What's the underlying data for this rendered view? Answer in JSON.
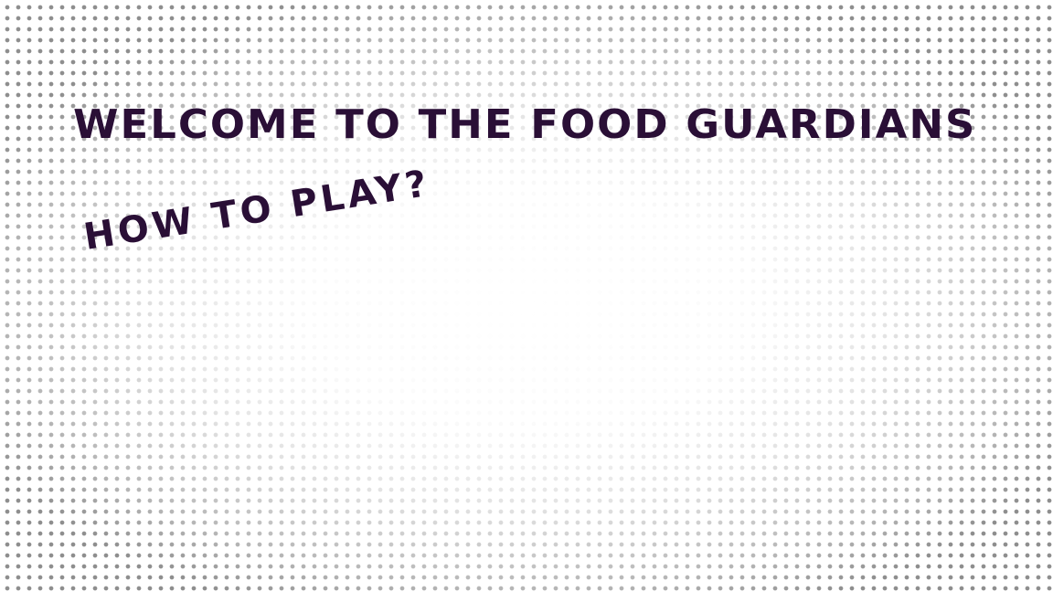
{
  "title": "WELCOME TO THE FOOD GUARDIANS",
  "how_to_play": "HOW TO PLAY?",
  "colors": {
    "text": "#2a0f36",
    "dots": "#8e8e8e",
    "background": "#ffffff"
  }
}
